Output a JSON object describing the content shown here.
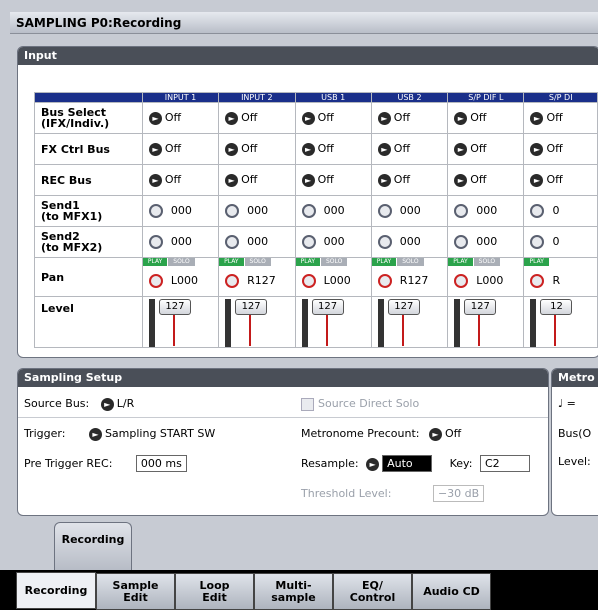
{
  "title": "SAMPLING P0:Recording",
  "input_panel": {
    "header": "Input",
    "columns": [
      "INPUT 1",
      "INPUT 2",
      "USB 1",
      "USB 2",
      "S/P DIF L",
      "S/P DI"
    ],
    "rows": {
      "bus_select": {
        "label": "Bus Select\n(IFX/Indiv.)",
        "values": [
          "Off",
          "Off",
          "Off",
          "Off",
          "Off",
          "Off"
        ]
      },
      "fx_ctrl_bus": {
        "label": "FX Ctrl Bus",
        "values": [
          "Off",
          "Off",
          "Off",
          "Off",
          "Off",
          "Off"
        ]
      },
      "rec_bus": {
        "label": "REC Bus",
        "values": [
          "Off",
          "Off",
          "Off",
          "Off",
          "Off",
          "Off"
        ]
      },
      "send1": {
        "label": "Send1\n(to MFX1)",
        "values": [
          "000",
          "000",
          "000",
          "000",
          "000",
          "0"
        ]
      },
      "send2": {
        "label": "Send2\n(to MFX2)",
        "values": [
          "000",
          "000",
          "000",
          "000",
          "000",
          "0"
        ]
      },
      "pan": {
        "label": "Pan",
        "values": [
          "L000",
          "R127",
          "L000",
          "R127",
          "L000",
          "R"
        ]
      },
      "level": {
        "label": "Level",
        "values": [
          "127",
          "127",
          "127",
          "127",
          "127",
          "12"
        ],
        "fractions": [
          1,
          1,
          1,
          1,
          1,
          1
        ]
      }
    },
    "play_label": "PLAY",
    "solo_label": "SOLO"
  },
  "sampling_setup": {
    "header": "Sampling Setup",
    "source_bus_label": "Source Bus:",
    "source_bus_value": "L/R",
    "source_direct_solo": "Source Direct Solo",
    "trigger_label": "Trigger:",
    "trigger_value": "Sampling START SW",
    "metronome_precount_label": "Metronome Precount:",
    "metronome_precount_value": "Off",
    "pre_trigger_label": "Pre Trigger REC:",
    "pre_trigger_value": "000 ms",
    "resample_label": "Resample:",
    "resample_value": "Auto",
    "key_label": "Key:",
    "key_value": "C2",
    "threshold_label": "Threshold Level:",
    "threshold_value": "−30 dB"
  },
  "metronome": {
    "header": "Metro",
    "note": "♩ =",
    "bus": "Bus(O",
    "level": "Level:"
  },
  "lower_tab": "Recording",
  "tabs": [
    {
      "label": "Recording"
    },
    {
      "label": "Sample\nEdit"
    },
    {
      "label": "Loop\nEdit"
    },
    {
      "label": "Multi-\nsample"
    },
    {
      "label": "EQ/\nControl"
    },
    {
      "label": "Audio CD"
    }
  ]
}
